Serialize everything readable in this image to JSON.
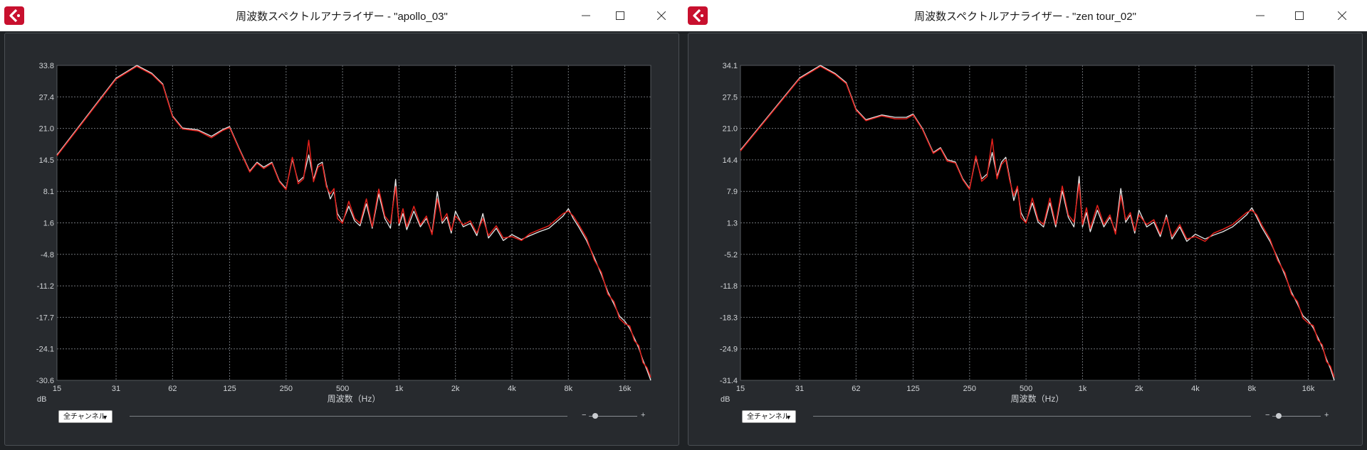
{
  "colors": {
    "titlebar_bg": "#ffffff",
    "panel_bg": "#272a2e",
    "plot_bg": "#000000",
    "grid": "#6f7378",
    "trace_white": "#e8e8e8",
    "trace_red": "#e3201b",
    "brand_red": "#c8102e"
  },
  "windows": [
    {
      "title": "周波数スペクトルアナライザー - \"apollo_03\"",
      "icons": {
        "logo": "cubase-logo-icon",
        "minimize": "minimize-icon",
        "maximize": "maximize-icon",
        "close": "close-icon"
      },
      "y_unit": "dB",
      "x_title": "周波数（Hz）",
      "channel_select": "全チャンネル",
      "chart_data": {
        "type": "line",
        "title": "",
        "xlabel": "周波数（Hz）",
        "ylabel": "dB",
        "x_scale": "log",
        "x_tick_labels": [
          "15",
          "31",
          "62",
          "125",
          "250",
          "500",
          "1k",
          "2k",
          "4k",
          "8k",
          "16k"
        ],
        "x_tick_values": [
          15,
          31,
          62,
          125,
          250,
          500,
          1000,
          2000,
          4000,
          8000,
          16000
        ],
        "y_tick_labels": [
          "33.8",
          "27.4",
          "21.0",
          "14.5",
          "8.1",
          "1.6",
          "-4.8",
          "-11.2",
          "-17.7",
          "-24.1",
          "-30.6"
        ],
        "ylim": [
          -30.6,
          33.8
        ],
        "xlim": [
          15,
          22000
        ],
        "grid": true,
        "series": [
          {
            "color": "#e8e8e8",
            "x": [
              15,
              31,
              40,
              48,
              55,
              62,
              70,
              85,
              100,
              115,
              125,
              140,
              160,
              175,
              190,
              210,
              230,
              250,
              270,
              290,
              310,
              330,
              350,
              370,
              390,
              410,
              430,
              450,
              470,
              500,
              540,
              580,
              620,
              670,
              720,
              780,
              840,
              900,
              960,
              1000,
              1050,
              1100,
              1200,
              1300,
              1400,
              1500,
              1600,
              1700,
              1800,
              1900,
              2000,
              2200,
              2400,
              2600,
              2800,
              3000,
              3300,
              3600,
              4000,
              4500,
              5000,
              5600,
              6300,
              7000,
              7500,
              8000,
              8500,
              9000,
              10000,
              11000,
              12000,
              13000,
              14000,
              15000,
              16000,
              17000,
              18000,
              19000,
              20000,
              21000,
              22000
            ],
            "y": [
              15.5,
              31.2,
              33.8,
              32.2,
              30.0,
              23.5,
              21.0,
              20.6,
              19.3,
              20.7,
              21.3,
              17.0,
              12.2,
              14.0,
              13.0,
              14.0,
              10.2,
              8.6,
              14.6,
              10.0,
              11.0,
              15.5,
              10.5,
              13.5,
              14.0,
              9.5,
              6.5,
              8.0,
              3.5,
              1.8,
              5.0,
              2.0,
              1.0,
              5.5,
              0.5,
              7.5,
              2.5,
              0.5,
              10.5,
              1.0,
              3.5,
              0.2,
              4.0,
              0.8,
              2.5,
              -0.5,
              8.0,
              1.5,
              2.8,
              -0.5,
              4.0,
              0.8,
              1.5,
              -1.0,
              3.5,
              -1.5,
              0.5,
              -2.0,
              -0.8,
              -1.8,
              -1.0,
              -0.2,
              0.5,
              2.0,
              3.0,
              4.5,
              2.5,
              1.0,
              -2.0,
              -5.5,
              -9.0,
              -12.5,
              -15.0,
              -17.5,
              -18.5,
              -20.0,
              -22.0,
              -24.0,
              -26.5,
              -28.5,
              -30.6
            ]
          },
          {
            "color": "#e3201b",
            "x": [
              15,
              31,
              40,
              48,
              55,
              62,
              70,
              85,
              100,
              115,
              125,
              140,
              160,
              175,
              190,
              210,
              230,
              250,
              270,
              290,
              310,
              330,
              350,
              370,
              390,
              410,
              430,
              450,
              470,
              500,
              540,
              580,
              620,
              670,
              720,
              780,
              840,
              900,
              960,
              1000,
              1050,
              1100,
              1200,
              1300,
              1400,
              1500,
              1600,
              1700,
              1800,
              1900,
              2000,
              2200,
              2400,
              2600,
              2800,
              3000,
              3300,
              3600,
              4000,
              4500,
              5000,
              5600,
              6300,
              7000,
              7500,
              8000,
              8500,
              9000,
              10000,
              11000,
              12000,
              13000,
              14000,
              15000,
              16000,
              17000,
              18000,
              19000,
              20000,
              21000,
              22000
            ],
            "y": [
              15.3,
              31.0,
              33.6,
              32.0,
              29.8,
              23.3,
              20.8,
              20.4,
              19.0,
              20.5,
              21.1,
              16.8,
              12.0,
              13.8,
              12.7,
              13.8,
              10.0,
              8.4,
              15.0,
              9.6,
              10.6,
              18.5,
              10.0,
              13.0,
              13.6,
              9.0,
              7.5,
              8.6,
              2.5,
              1.5,
              6.0,
              2.5,
              1.5,
              6.5,
              0.8,
              8.5,
              3.0,
              1.5,
              9.0,
              1.5,
              4.5,
              0.8,
              5.0,
              1.2,
              3.0,
              -0.8,
              6.5,
              2.0,
              3.5,
              0.0,
              3.0,
              1.2,
              2.0,
              -0.5,
              2.5,
              -1.0,
              1.0,
              -1.5,
              -1.2,
              -2.0,
              -0.6,
              0.2,
              1.0,
              2.5,
              3.5,
              4.0,
              3.0,
              1.5,
              -1.5,
              -6.0,
              -8.5,
              -13.0,
              -14.5,
              -18.0,
              -19.0,
              -19.5,
              -22.5,
              -23.5,
              -27.0,
              -28.0,
              -30.0
            ]
          }
        ]
      }
    },
    {
      "title": "周波数スペクトルアナライザー - \"zen tour_02\"",
      "icons": {
        "logo": "cubase-logo-icon",
        "minimize": "minimize-icon",
        "maximize": "maximize-icon",
        "close": "close-icon"
      },
      "y_unit": "dB",
      "x_title": "周波数（Hz）",
      "channel_select": "全チャンネル",
      "chart_data": {
        "type": "line",
        "title": "",
        "xlabel": "周波数（Hz）",
        "ylabel": "dB",
        "x_scale": "log",
        "x_tick_labels": [
          "15",
          "31",
          "62",
          "125",
          "250",
          "500",
          "1k",
          "2k",
          "4k",
          "8k",
          "16k"
        ],
        "x_tick_values": [
          15,
          31,
          62,
          125,
          250,
          500,
          1000,
          2000,
          4000,
          8000,
          16000
        ],
        "y_tick_labels": [
          "34.1",
          "27.5",
          "21.0",
          "14.4",
          "7.9",
          "1.3",
          "-5.2",
          "-11.8",
          "-18.3",
          "-24.9",
          "-31.4"
        ],
        "ylim": [
          -31.4,
          34.1
        ],
        "xlim": [
          15,
          22000
        ],
        "grid": true,
        "series": [
          {
            "color": "#e8e8e8",
            "x": [
              15,
              31,
              40,
              48,
              55,
              62,
              70,
              85,
              100,
              115,
              125,
              140,
              160,
              175,
              190,
              210,
              230,
              250,
              270,
              290,
              310,
              330,
              350,
              370,
              390,
              410,
              430,
              450,
              470,
              500,
              540,
              580,
              620,
              670,
              720,
              780,
              840,
              900,
              960,
              1000,
              1050,
              1100,
              1200,
              1300,
              1400,
              1500,
              1600,
              1700,
              1800,
              1900,
              2000,
              2200,
              2400,
              2600,
              2800,
              3000,
              3300,
              3600,
              4000,
              4500,
              5000,
              5600,
              6300,
              7000,
              7500,
              8000,
              8500,
              9000,
              10000,
              11000,
              12000,
              13000,
              14000,
              15000,
              16000,
              17000,
              18000,
              19000,
              20000,
              21000,
              22000
            ],
            "y": [
              16.5,
              31.5,
              34.1,
              32.4,
              30.5,
              25.0,
              22.8,
              23.8,
              23.3,
              23.3,
              24.0,
              21.0,
              16.0,
              17.0,
              14.5,
              14.0,
              10.5,
              8.5,
              14.8,
              10.5,
              11.5,
              16.0,
              11.0,
              14.0,
              15.0,
              10.5,
              6.0,
              8.5,
              3.5,
              1.5,
              5.5,
              1.5,
              0.5,
              5.5,
              0.5,
              8.0,
              2.5,
              0.5,
              11.0,
              0.5,
              3.5,
              -0.5,
              4.0,
              0.5,
              2.5,
              -0.5,
              8.5,
              1.5,
              3.0,
              -0.8,
              4.0,
              0.5,
              1.5,
              -1.5,
              3.0,
              -2.0,
              0.5,
              -2.5,
              -1.0,
              -2.0,
              -1.2,
              -0.5,
              0.5,
              2.0,
              3.0,
              4.5,
              2.5,
              0.5,
              -2.5,
              -6.0,
              -9.5,
              -13.0,
              -15.5,
              -18.0,
              -19.0,
              -20.5,
              -22.5,
              -24.5,
              -27.0,
              -29.0,
              -31.4
            ]
          },
          {
            "color": "#e3201b",
            "x": [
              15,
              31,
              40,
              48,
              55,
              62,
              70,
              85,
              100,
              115,
              125,
              140,
              160,
              175,
              190,
              210,
              230,
              250,
              270,
              290,
              310,
              330,
              350,
              370,
              390,
              410,
              430,
              450,
              470,
              500,
              540,
              580,
              620,
              670,
              720,
              780,
              840,
              900,
              960,
              1000,
              1050,
              1100,
              1200,
              1300,
              1400,
              1500,
              1600,
              1700,
              1800,
              1900,
              2000,
              2200,
              2400,
              2600,
              2800,
              3000,
              3300,
              3600,
              4000,
              4500,
              5000,
              5600,
              6300,
              7000,
              7500,
              8000,
              8500,
              9000,
              10000,
              11000,
              12000,
              13000,
              14000,
              15000,
              16000,
              17000,
              18000,
              19000,
              20000,
              21000,
              22000
            ],
            "y": [
              16.3,
              31.3,
              33.9,
              32.2,
              30.3,
              24.8,
              22.6,
              23.6,
              23.0,
              23.0,
              23.8,
              20.8,
              15.8,
              16.8,
              14.2,
              13.8,
              10.3,
              8.3,
              15.3,
              10.0,
              11.0,
              18.8,
              10.5,
              13.5,
              14.5,
              10.0,
              7.0,
              9.0,
              2.5,
              1.3,
              6.5,
              2.0,
              1.0,
              6.5,
              1.0,
              9.0,
              3.0,
              1.5,
              9.5,
              1.0,
              4.5,
              0.2,
              5.0,
              1.0,
              3.0,
              -1.0,
              7.0,
              2.0,
              3.5,
              -0.3,
              3.0,
              1.0,
              2.0,
              -1.0,
              2.5,
              -1.5,
              1.0,
              -2.0,
              -1.5,
              -2.5,
              -0.8,
              0.0,
              1.0,
              2.5,
              3.5,
              4.0,
              3.0,
              1.0,
              -2.0,
              -6.5,
              -9.0,
              -13.5,
              -15.0,
              -18.5,
              -19.5,
              -20.0,
              -23.0,
              -24.0,
              -27.5,
              -28.5,
              -30.8
            ]
          }
        ]
      }
    }
  ]
}
